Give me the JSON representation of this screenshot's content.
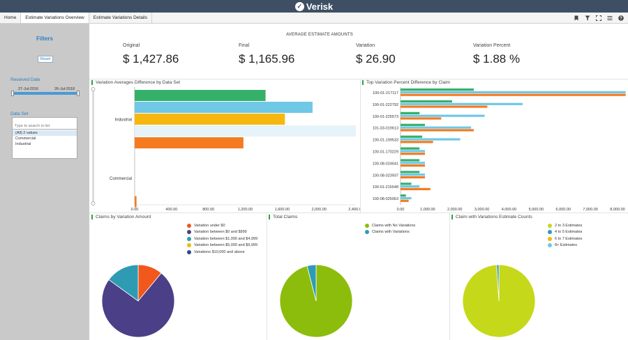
{
  "app": {
    "brand": "Verisk"
  },
  "tabs": [
    {
      "label": "Home"
    },
    {
      "label": "Estimate Variations Overview"
    },
    {
      "label": "Estimate Variations Details"
    }
  ],
  "toolbar": {
    "icons": [
      "bookmark-icon",
      "filter-icon",
      "fullscreen-icon",
      "menu-icon",
      "help-icon"
    ]
  },
  "filters": {
    "title": "Filters",
    "reset_label": "Reset",
    "received_date_label": "Received Date",
    "date_start": "27-Jul-2016",
    "date_end": "26-Jul-2018",
    "dataset_label": "Data Set",
    "dataset_placeholder": "Type to search in list",
    "dataset_options": [
      "(All) 2 values",
      "Commercial",
      "Industrial"
    ],
    "dataset_selected": "(All) 2 values"
  },
  "kpis": {
    "section_title": "AVERAGE ESTIMATE AMOUNTS",
    "original": {
      "label": "Original",
      "value": "$ 1,427.86"
    },
    "final": {
      "label": "Final",
      "value": "$ 1,165.96"
    },
    "variation": {
      "label": "Variation",
      "value": "$ 26.90"
    },
    "variation_percent": {
      "label": "Variation Percent",
      "value": "$ 1.88 %"
    }
  },
  "colors": {
    "green": "#35b06a",
    "light_blue": "#6fc8e6",
    "yellow": "#f6b80f",
    "pale_blue": "#e6f3f8",
    "orange": "#f47b20",
    "purple": "#4b3f87",
    "teal": "#2f9bb3",
    "red_orange": "#f2571c",
    "lime_green": "#8cbd0c",
    "yellow_green": "#c6d81a",
    "accent_blue": "#2a7fc2",
    "header_bg": "#3e4f63",
    "sidebar_bg": "#c9c9c9"
  },
  "panels": {
    "variation_averages_title": "Variation Averages Difference by Data Set",
    "top_variation_title": "Top Variation Percent Difference by Claim",
    "claims_by_amount_title": "Claims by Variation Amount",
    "total_claims_title": "Total Claims",
    "estimate_counts_title": "Claim with Variations Estimate Counts"
  },
  "chart_data": [
    {
      "type": "bar",
      "orientation": "horizontal",
      "title": "Variation Averages Difference by Data Set",
      "categories": [
        "Industrial",
        "Commercial"
      ],
      "series": [
        {
          "color": "#35b06a",
          "values": [
            1420,
            0
          ]
        },
        {
          "color": "#6fc8e6",
          "values": [
            1930,
            0
          ]
        },
        {
          "color": "#f6b80f",
          "values": [
            1630,
            0
          ]
        },
        {
          "color": "#e6f3f8",
          "values": [
            2420,
            0
          ]
        },
        {
          "color": "#f47b20",
          "values": [
            1180,
            20
          ]
        }
      ],
      "xlim": [
        0,
        2400
      ],
      "xticks": [
        "0.00",
        "400.00",
        "800.00",
        "1,200.00",
        "1,600.00",
        "2,000.00",
        "2,400.00"
      ]
    },
    {
      "type": "bar",
      "orientation": "horizontal",
      "title": "Top Variation Percent Difference by Claim",
      "categories": [
        "100-01-217117",
        "100-01-222792",
        "100-01-225573",
        "101-03-019613",
        "100-01-199533",
        "100-01-170229",
        "100-08-024641",
        "100-08-023937",
        "100-01-215548",
        "100-08-025063"
      ],
      "series": [
        {
          "color": "#35b06a",
          "values": [
            2700,
            1900,
            700,
            900,
            800,
            700,
            700,
            700,
            400,
            200
          ]
        },
        {
          "color": "#6fc8e6",
          "values": [
            8300,
            4500,
            3100,
            2600,
            2200,
            900,
            900,
            900,
            700,
            400
          ]
        },
        {
          "color": "#f47b20",
          "values": [
            8300,
            3200,
            1500,
            2700,
            1200,
            900,
            900,
            900,
            1100,
            300
          ]
        },
        {
          "color": "#f6b80f",
          "values": [
            0,
            0,
            0,
            0,
            0,
            0,
            0,
            0,
            0,
            0
          ]
        }
      ],
      "xlim": [
        0,
        8000
      ],
      "xticks": [
        "0.00",
        "1,000.00",
        "2,000.00",
        "3,000.00",
        "4,000.00",
        "5,000.00",
        "6,000.00",
        "7,000.00",
        "8,000.00"
      ]
    },
    {
      "type": "pie",
      "title": "Claims by Variation Amount",
      "labels": [
        "Variation under $0",
        "Variation between $0 and $999",
        "Variation between $1,000 and $4,999",
        "Variation between $5,000 and $9,999",
        "Variations $10,000 and above"
      ],
      "colors": [
        "#f2571c",
        "#4b3f87",
        "#2f9bb3",
        "#f6b80f",
        "#2d4a8a"
      ],
      "values": [
        11,
        74,
        15,
        0,
        0
      ]
    },
    {
      "type": "pie",
      "title": "Total Claims",
      "labels": [
        "Claims with No Variations",
        "Claims with Variations"
      ],
      "colors": [
        "#8cbd0c",
        "#2f9bb3"
      ],
      "values": [
        96,
        4
      ]
    },
    {
      "type": "pie",
      "title": "Claim with Variations Estimate Counts",
      "labels": [
        "2 to 3 Estimates",
        "4 to 5 Estimates",
        "6 to 7 Estimates",
        "8+ Estimates"
      ],
      "colors": [
        "#c6d81a",
        "#2f9bb3",
        "#f6b80f",
        "#6fc8e6"
      ],
      "values": [
        99,
        1,
        0,
        0
      ]
    }
  ]
}
